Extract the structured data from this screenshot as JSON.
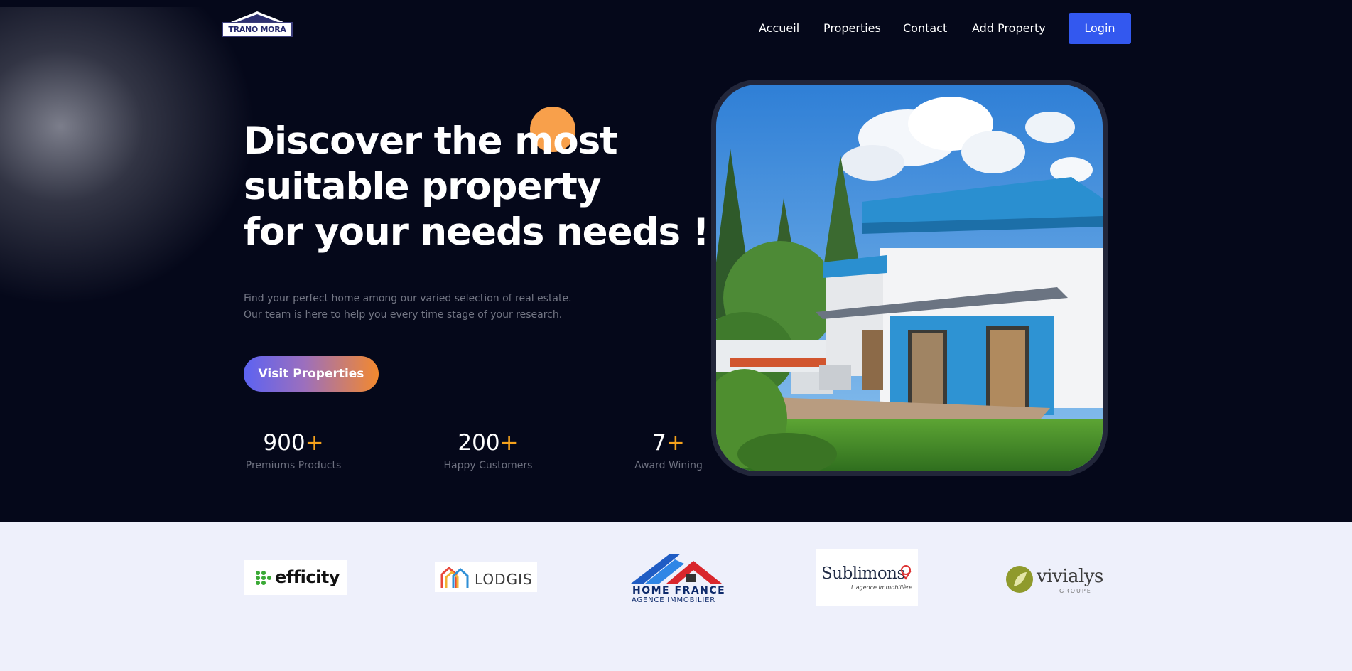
{
  "brand": {
    "logo_text": "TRANO MORA"
  },
  "nav": {
    "items": [
      "Accueil",
      "Properties",
      "Contact",
      "Add Property"
    ],
    "login_label": "Login"
  },
  "hero": {
    "headline_lines": [
      "Discover the most",
      "suitable property",
      "for your needs needs !"
    ],
    "subtitle_lines": [
      "Find your perfect home among our varied selection of real estate.",
      "Our team is here to help you every time stage of your research."
    ],
    "cta_label": "Visit Properties",
    "image_description": "modern-house-photo"
  },
  "stats": [
    {
      "value": "900",
      "suffix": "+",
      "label": "Premiums Products"
    },
    {
      "value": "200",
      "suffix": "+",
      "label": "Happy Customers"
    },
    {
      "value": "7",
      "suffix": "+",
      "label": "Award Wining"
    }
  ],
  "partners": [
    {
      "name": "efficity",
      "logo_text": "efficity"
    },
    {
      "name": "lodgis",
      "logo_text": "LODGIS"
    },
    {
      "name": "home-france",
      "logo_text": "HOME FRANCE",
      "logo_subtext": "AGENCE IMMOBILIER"
    },
    {
      "name": "sublimons",
      "logo_text": "Sublimons",
      "logo_subtext": "L'agence immobilière"
    },
    {
      "name": "vivialys",
      "logo_text": "vivialys",
      "logo_subtext": "GROUPE"
    }
  ],
  "colors": {
    "hero_bg": "#05081a",
    "accent_blue": "#3358ef",
    "accent_orange": "#f6a21c",
    "partners_bg": "#eef0fb"
  }
}
